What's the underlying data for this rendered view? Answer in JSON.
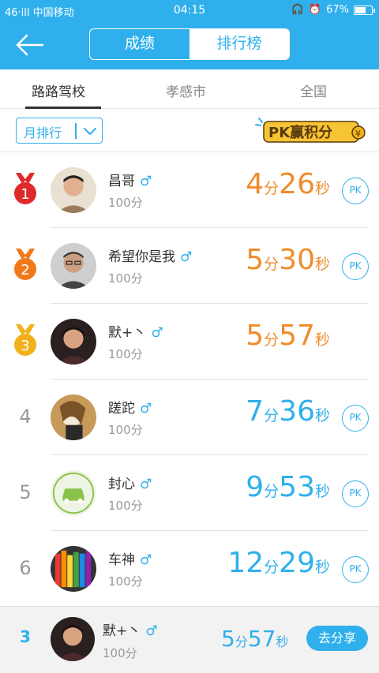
{
  "status_bar": {
    "left": "46·ill 中国移动",
    "time": "04:15",
    "battery": "67%",
    "battery_level": 0.67
  },
  "header": {
    "segments": [
      {
        "label": "成绩",
        "active": false
      },
      {
        "label": "排行榜",
        "active": true
      }
    ]
  },
  "tabs": [
    {
      "label": "路路驾校",
      "active": true
    },
    {
      "label": "孝感市",
      "active": false
    },
    {
      "label": "全国",
      "active": false
    }
  ],
  "filter": {
    "dropdown_value": "月排行",
    "logo_text": "PK赢积分"
  },
  "list": [
    {
      "rank": "1",
      "medal": "red",
      "name": "昌哥",
      "gender": "♂",
      "score": "100分",
      "min": "4",
      "min_unit": "分",
      "sec": "26",
      "sec_unit": "秒",
      "time_color": "orange",
      "pk": "PK",
      "show_pk": true,
      "avatar": "photo-boy"
    },
    {
      "rank": "2",
      "medal": "orange",
      "name": "希望你是我",
      "gender": "♂",
      "score": "100分",
      "min": "5",
      "min_unit": "分",
      "sec": "30",
      "sec_unit": "秒",
      "time_color": "orange",
      "pk": "PK",
      "show_pk": true,
      "avatar": "photo-glasses"
    },
    {
      "rank": "3",
      "medal": "gold",
      "name": "默+丶",
      "gender": "♂",
      "score": "100分",
      "min": "5",
      "min_unit": "分",
      "sec": "57",
      "sec_unit": "秒",
      "time_color": "orange",
      "pk": "",
      "show_pk": false,
      "avatar": "photo-young"
    },
    {
      "rank": "4",
      "medal": "",
      "name": "蹉跎",
      "gender": "♂",
      "score": "100分",
      "min": "7",
      "min_unit": "分",
      "sec": "36",
      "sec_unit": "秒",
      "time_color": "blue",
      "pk": "PK",
      "show_pk": true,
      "avatar": "photo-girl"
    },
    {
      "rank": "5",
      "medal": "",
      "name": "封心",
      "gender": "♂",
      "score": "100分",
      "min": "9",
      "min_unit": "分",
      "sec": "53",
      "sec_unit": "秒",
      "time_color": "blue",
      "pk": "PK",
      "show_pk": true,
      "avatar": "car-icon"
    },
    {
      "rank": "6",
      "medal": "",
      "name": "车神",
      "gender": "♂",
      "score": "100分",
      "min": "12",
      "min_unit": "分",
      "sec": "29",
      "sec_unit": "秒",
      "time_color": "blue",
      "pk": "PK",
      "show_pk": true,
      "avatar": "pencils"
    }
  ],
  "me": {
    "rank": "3",
    "name": "默+丶",
    "gender": "♂",
    "score": "100分",
    "min": "5",
    "min_unit": "分",
    "sec": "57",
    "sec_unit": "秒",
    "share_label": "去分享"
  },
  "colors": {
    "primary": "#2fb0ec",
    "orange": "#f08c2b",
    "medal_red": "#e02a2a",
    "medal_orange": "#f07a1a",
    "medal_gold": "#f2b11a"
  }
}
